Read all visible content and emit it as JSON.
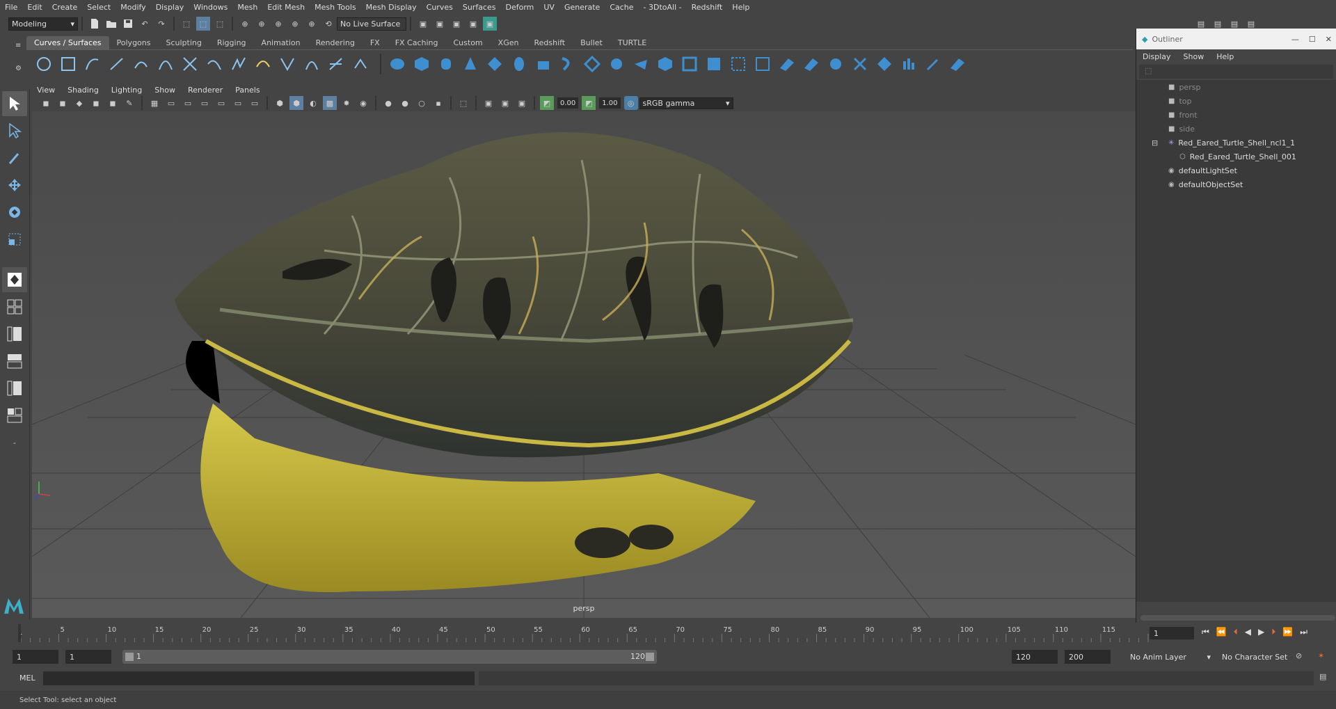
{
  "menubar": [
    "File",
    "Edit",
    "Create",
    "Select",
    "Modify",
    "Display",
    "Windows",
    "Mesh",
    "Edit Mesh",
    "Mesh Tools",
    "Mesh Display",
    "Curves",
    "Surfaces",
    "Deform",
    "UV",
    "Generate",
    "Cache",
    "- 3DtoAll -",
    "Redshift",
    "Help"
  ],
  "statusline": {
    "mode": "Modeling",
    "live_surface": "No Live Surface"
  },
  "shelf_tabs": [
    "Curves / Surfaces",
    "Polygons",
    "Sculpting",
    "Rigging",
    "Animation",
    "Rendering",
    "FX",
    "FX Caching",
    "Custom",
    "XGen",
    "Redshift",
    "Bullet",
    "TURTLE"
  ],
  "viewport_menu": [
    "View",
    "Shading",
    "Lighting",
    "Show",
    "Renderer",
    "Panels"
  ],
  "viewport_toolbar": {
    "exposure": "0.00",
    "gamma": "1.00",
    "color_space": "sRGB gamma"
  },
  "viewport": {
    "camera_label": "persp"
  },
  "outliner": {
    "title": "Outliner",
    "menu": [
      "Display",
      "Show",
      "Help"
    ],
    "items": [
      {
        "label": "persp",
        "icon": "camera-icon",
        "dim": true
      },
      {
        "label": "top",
        "icon": "camera-icon",
        "dim": true
      },
      {
        "label": "front",
        "icon": "camera-icon",
        "dim": true
      },
      {
        "label": "side",
        "icon": "camera-icon",
        "dim": true
      },
      {
        "label": "Red_Eared_Turtle_Shell_ncl1_1",
        "icon": "group-icon",
        "dim": false
      },
      {
        "label": "Red_Eared_Turtle_Shell_001",
        "icon": "mesh-icon",
        "dim": false
      },
      {
        "label": "defaultLightSet",
        "icon": "set-icon",
        "dim": false
      },
      {
        "label": "defaultObjectSet",
        "icon": "set-icon",
        "dim": false
      }
    ]
  },
  "timeline": {
    "ticks": [
      "5",
      "10",
      "15",
      "20",
      "25",
      "30",
      "35",
      "40",
      "45",
      "50",
      "55",
      "60",
      "65",
      "70",
      "75",
      "80",
      "85",
      "90",
      "95",
      "100",
      "105",
      "110",
      "115"
    ],
    "start_label": "1",
    "current_frame": "1"
  },
  "range": {
    "start": "1",
    "anim_start": "1",
    "slider_start": "1",
    "slider_end": "120",
    "anim_end": "120",
    "end": "200",
    "anim_layer": "No Anim Layer",
    "character_set": "No Character Set"
  },
  "command": {
    "label": "MEL"
  },
  "help_line": "Select Tool: select an object"
}
